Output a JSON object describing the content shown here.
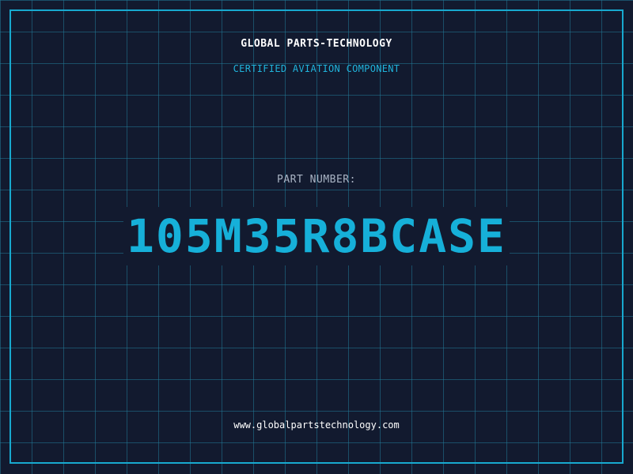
{
  "header": {
    "company": "GLOBAL PARTS-TECHNOLOGY",
    "tagline": "CERTIFIED AVIATION COMPONENT"
  },
  "part": {
    "label": "PART NUMBER:",
    "number": "105M35R8BCASE"
  },
  "footer": {
    "url": "www.globalpartstechnology.com"
  },
  "colors": {
    "background": "#121a2f",
    "grid": "#22789a",
    "accent": "#16b0d9",
    "label": "#a9b4c4",
    "text": "#ffffff"
  }
}
